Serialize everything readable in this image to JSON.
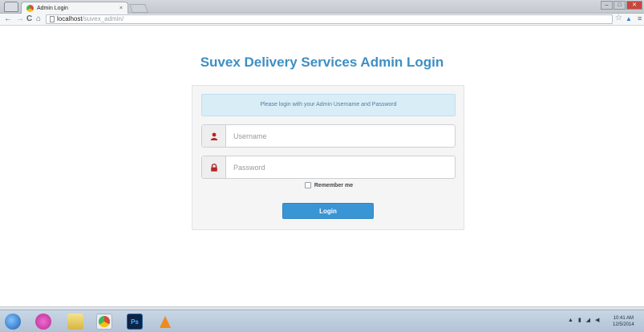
{
  "browser": {
    "tab_title": "Admin Login",
    "tab_close": "×",
    "url_host": "localhost",
    "url_path": "/suvex_admin/"
  },
  "page": {
    "title": "Suvex Delivery Services Admin Login",
    "alert": "Please login with your Admin Username and Password",
    "username_placeholder": "Username",
    "password_placeholder": "Password",
    "remember_label": "Remember me",
    "login_label": "Login"
  },
  "taskbar": {
    "ps_label": "Ps",
    "clock_time": "10:41 AM",
    "clock_date": "12/5/2014"
  },
  "colors": {
    "accent": "#3a95d5",
    "title": "#3d8fc4",
    "alert_bg": "#d9edf7",
    "icon_red": "#b52626"
  },
  "icons": [
    "user-icon",
    "lock-icon",
    "star-icon",
    "chrome-icon",
    "photoshop-icon",
    "vlc-icon",
    "windows-start-icon"
  ]
}
